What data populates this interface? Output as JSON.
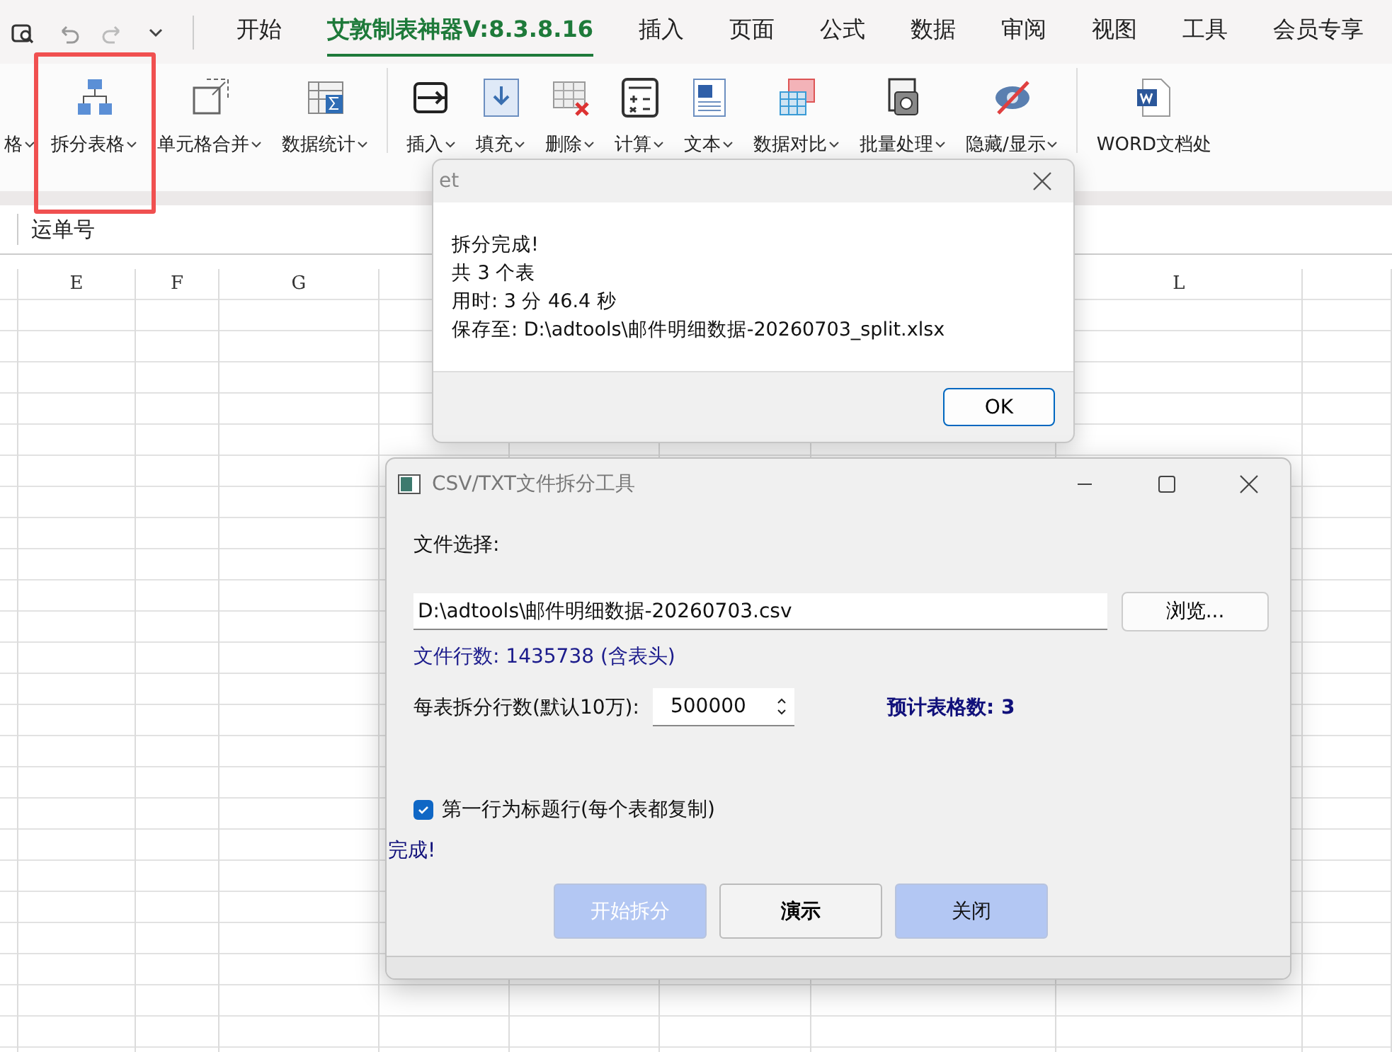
{
  "menu_tabs": [
    {
      "label": "开始",
      "selected": false
    },
    {
      "label": "艾敦制表神器V:8.3.8.16",
      "selected": true
    },
    {
      "label": "插入",
      "selected": false
    },
    {
      "label": "页面",
      "selected": false
    },
    {
      "label": "公式",
      "selected": false
    },
    {
      "label": "数据",
      "selected": false
    },
    {
      "label": "审阅",
      "selected": false
    },
    {
      "label": "视图",
      "selected": false
    },
    {
      "label": "工具",
      "selected": false
    },
    {
      "label": "会员专享",
      "selected": false
    }
  ],
  "ribbon": [
    {
      "label": "格"
    },
    {
      "label": "拆分表格"
    },
    {
      "label": "单元格合并"
    },
    {
      "label": "数据统计"
    },
    {
      "label": "插入"
    },
    {
      "label": "填充"
    },
    {
      "label": "删除"
    },
    {
      "label": "计算"
    },
    {
      "label": "文本"
    },
    {
      "label": "数据对比"
    },
    {
      "label": "批量处理"
    },
    {
      "label": "隐藏/显示"
    },
    {
      "label": "WORD文档处"
    }
  ],
  "formula_bar": {
    "value": "运单号"
  },
  "sheet": {
    "columns": [
      "E",
      "F",
      "G",
      "L"
    ]
  },
  "message_box": {
    "title": "et",
    "lines": [
      "拆分完成!",
      "共 3 个表",
      "用时: 3 分 46.4 秒",
      "保存至: D:\\adtools\\邮件明细数据-20260703_split.xlsx"
    ],
    "button": "OK"
  },
  "tool_window": {
    "title": "CSV/TXT文件拆分工具",
    "file_label": "文件选择:",
    "file_path": "D:\\adtools\\邮件明细数据-20260703.csv",
    "browse_button": "浏览...",
    "row_count": "文件行数: 1435738 (含表头)",
    "split_label": "每表拆分行数(默认10万):",
    "split_value": "500000",
    "estimate": "预计表格数: 3",
    "header_option": {
      "label": "第一行为标题行(每个表都复制)",
      "checked": true
    },
    "status": "完成!",
    "buttons": [
      {
        "label": "开始拆分",
        "kind": "primary",
        "disabled": true
      },
      {
        "label": "演示",
        "kind": "default",
        "disabled": false
      },
      {
        "label": "关闭",
        "kind": "primary",
        "disabled": false
      }
    ]
  }
}
